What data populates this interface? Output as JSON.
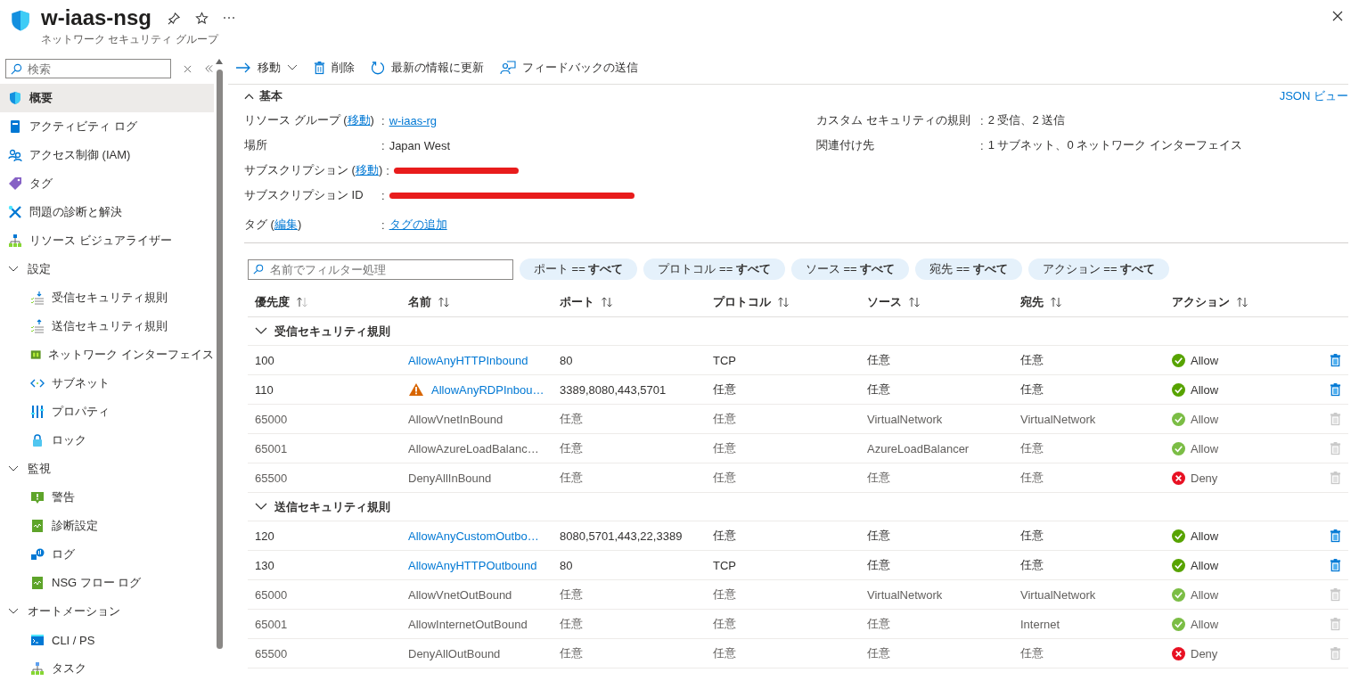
{
  "header": {
    "title": "w-iaas-nsg",
    "subtitle": "ネットワーク セキュリティ グループ"
  },
  "sidebar": {
    "search": {
      "placeholder": "検索"
    },
    "items": [
      {
        "label": "概要",
        "selected": true
      },
      {
        "label": "アクティビティ ログ",
        "selected": false
      },
      {
        "label": "アクセス制御 (IAM)",
        "selected": false
      },
      {
        "label": "タグ",
        "selected": false
      },
      {
        "label": "問題の診断と解決",
        "selected": false
      },
      {
        "label": "リソース ビジュアライザー",
        "selected": false
      },
      {
        "label": "設定",
        "expanded": true,
        "children": [
          {
            "label": "受信セキュリティ規則",
            "selected": false
          },
          {
            "label": "送信セキュリティ規則",
            "selected": false
          },
          {
            "label": "ネットワーク インターフェイス",
            "selected": false
          },
          {
            "label": "サブネット",
            "selected": false
          },
          {
            "label": "プロパティ",
            "selected": false
          },
          {
            "label": "ロック",
            "selected": false
          }
        ]
      },
      {
        "label": "監視",
        "expanded": true,
        "children": [
          {
            "label": "警告",
            "selected": false
          },
          {
            "label": "診断設定",
            "selected": false
          },
          {
            "label": "ログ",
            "selected": false
          },
          {
            "label": "NSG フロー ログ",
            "selected": false
          }
        ]
      },
      {
        "label": "オートメーション",
        "expanded": true,
        "children": [
          {
            "label": "CLI / PS",
            "selected": false
          },
          {
            "label": "タスク",
            "selected": false
          }
        ]
      }
    ]
  },
  "toolbar": [
    {
      "kind": "move",
      "label": "移動"
    },
    {
      "kind": "delete",
      "label": "削除"
    },
    {
      "kind": "refresh",
      "label": "最新の情報に更新"
    },
    {
      "kind": "feedback",
      "label": "フィードバックの送信"
    }
  ],
  "essentials": {
    "title": "基本",
    "expanded": true,
    "json_link": "JSON ビュー",
    "left": [
      {
        "label_before": "リソース グループ (",
        "label_link": "移動",
        "label_after": ")",
        "separator": ":",
        "value": "w-iaas-rg",
        "value_is_link": true,
        "redacted": false
      },
      {
        "label_before": "場所",
        "separator": ":",
        "value": "Japan West",
        "value_is_link": false,
        "redacted": false
      },
      {
        "label_before": "サブスクリプション (",
        "label_link": "移動",
        "label_after": ")",
        "separator": ":",
        "redacted": true
      },
      {
        "label_before": "サブスクリプション ID",
        "separator": ":",
        "redacted": true
      },
      {
        "label_before": "タグ (",
        "label_link": "編集",
        "label_after": ")",
        "separator": ":",
        "value": "タグの追加",
        "value_is_link": true,
        "redacted": false
      }
    ],
    "right": [
      {
        "label_before": "カスタム セキュリティの規則",
        "separator": ":",
        "value": "2 受信、2 送信",
        "value_is_link": false,
        "redacted": false
      },
      {
        "label_before": "関連付け先",
        "separator": ":",
        "value": "1 サブネット、0 ネットワーク インターフェイス",
        "value_is_link": false,
        "redacted": false
      }
    ]
  },
  "filter": {
    "placeholder": "名前でフィルター処理",
    "pills": [
      "ポート == **すべて**",
      "プロトコル == **すべて**",
      "ソース == **すべて**",
      "宛先 == **すべて**",
      "アクション == **すべて**"
    ]
  },
  "table": {
    "columns": [
      {
        "label": "優先度",
        "sorted": true
      },
      {
        "label": "名前",
        "sorted": false
      },
      {
        "label": "ポート",
        "sorted": false
      },
      {
        "label": "プロトコル",
        "sorted": false
      },
      {
        "label": "ソース",
        "sorted": false
      },
      {
        "label": "宛先",
        "sorted": false
      },
      {
        "label": "アクション",
        "sorted": false
      }
    ],
    "groups": [
      {
        "label": "受信セキュリティ規則",
        "expanded": true,
        "rows": [
          {
            "priority": "100",
            "name": "AllowAnyHTTPInbound",
            "port": "80",
            "protocol": "TCP",
            "source": "任意",
            "destination": "任意",
            "action": "Allow",
            "kind": "allow",
            "default_rule": false,
            "warning": false
          },
          {
            "priority": "110",
            "name": "AllowAnyRDPInbou…",
            "port": "3389,8080,443,5701",
            "protocol": "任意",
            "source": "任意",
            "destination": "任意",
            "action": "Allow",
            "kind": "allow",
            "default_rule": false,
            "warning": true
          },
          {
            "priority": "65000",
            "name": "AllowVnetInBound",
            "port": "任意",
            "protocol": "任意",
            "source": "VirtualNetwork",
            "destination": "VirtualNetwork",
            "action": "Allow",
            "kind": "allow",
            "default_rule": true,
            "warning": false
          },
          {
            "priority": "65001",
            "name": "AllowAzureLoadBalanc…",
            "port": "任意",
            "protocol": "任意",
            "source": "AzureLoadBalancer",
            "destination": "任意",
            "action": "Allow",
            "kind": "allow",
            "default_rule": true,
            "warning": false
          },
          {
            "priority": "65500",
            "name": "DenyAllInBound",
            "port": "任意",
            "protocol": "任意",
            "source": "任意",
            "destination": "任意",
            "action": "Deny",
            "kind": "deny",
            "default_rule": true,
            "warning": false
          }
        ]
      },
      {
        "label": "送信セキュリティ規則",
        "expanded": true,
        "rows": [
          {
            "priority": "120",
            "name": "AllowAnyCustomOutbo…",
            "port": "8080,5701,443,22,3389",
            "protocol": "任意",
            "source": "任意",
            "destination": "任意",
            "action": "Allow",
            "kind": "allow",
            "default_rule": false,
            "warning": false
          },
          {
            "priority": "130",
            "name": "AllowAnyHTTPOutbound",
            "port": "80",
            "protocol": "TCP",
            "source": "任意",
            "destination": "任意",
            "action": "Allow",
            "kind": "allow",
            "default_rule": false,
            "warning": false
          },
          {
            "priority": "65000",
            "name": "AllowVnetOutBound",
            "port": "任意",
            "protocol": "任意",
            "source": "VirtualNetwork",
            "destination": "VirtualNetwork",
            "action": "Allow",
            "kind": "allow",
            "default_rule": true,
            "warning": false
          },
          {
            "priority": "65001",
            "name": "AllowInternetOutBound",
            "port": "任意",
            "protocol": "任意",
            "source": "任意",
            "destination": "Internet",
            "action": "Allow",
            "kind": "allow",
            "default_rule": true,
            "warning": false
          },
          {
            "priority": "65500",
            "name": "DenyAllOutBound",
            "port": "任意",
            "protocol": "任意",
            "source": "任意",
            "destination": "任意",
            "action": "Deny",
            "kind": "deny",
            "default_rule": true,
            "warning": false
          }
        ]
      }
    ]
  }
}
